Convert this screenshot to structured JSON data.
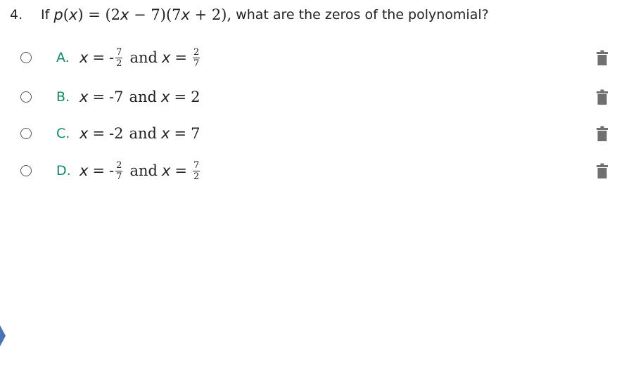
{
  "question": {
    "number": "4.",
    "prefix": "If",
    "func": "p",
    "arg": "x",
    "expr_open": "(2",
    "var1": "x",
    "expr_mid": " − 7)(7",
    "var2": "x",
    "expr_close": " + 2),",
    "tail": "what are the zeros of the polynomial?"
  },
  "choices": [
    {
      "letter": "A.",
      "var_a": "x",
      "eq_a": "=",
      "sign_a": "-",
      "num_a": "7",
      "den_a": "2",
      "and": "and",
      "var_b": "x",
      "eq_b": "=",
      "num_b": "2",
      "den_b": "7"
    },
    {
      "letter": "B.",
      "var_a": "x",
      "eq_a": "=",
      "val_a": "-7",
      "and": "and",
      "var_b": "x",
      "eq_b": "=",
      "val_b": "2"
    },
    {
      "letter": "C.",
      "var_a": "x",
      "eq_a": "=",
      "val_a": "-2",
      "and": "and",
      "var_b": "x",
      "eq_b": "=",
      "val_b": "7"
    },
    {
      "letter": "D.",
      "var_a": "x",
      "eq_a": "=",
      "sign_a": "-",
      "num_a": "2",
      "den_a": "7",
      "and": "and",
      "var_b": "x",
      "eq_b": "=",
      "num_b": "7",
      "den_b": "2"
    }
  ],
  "icons": {
    "radio": "radio-button-icon",
    "trash": "trash-icon",
    "nav": "chevron-left-icon"
  },
  "colors": {
    "letter": "#10876a",
    "trash": "#707070",
    "nav_arrow": "#4a72b5"
  }
}
